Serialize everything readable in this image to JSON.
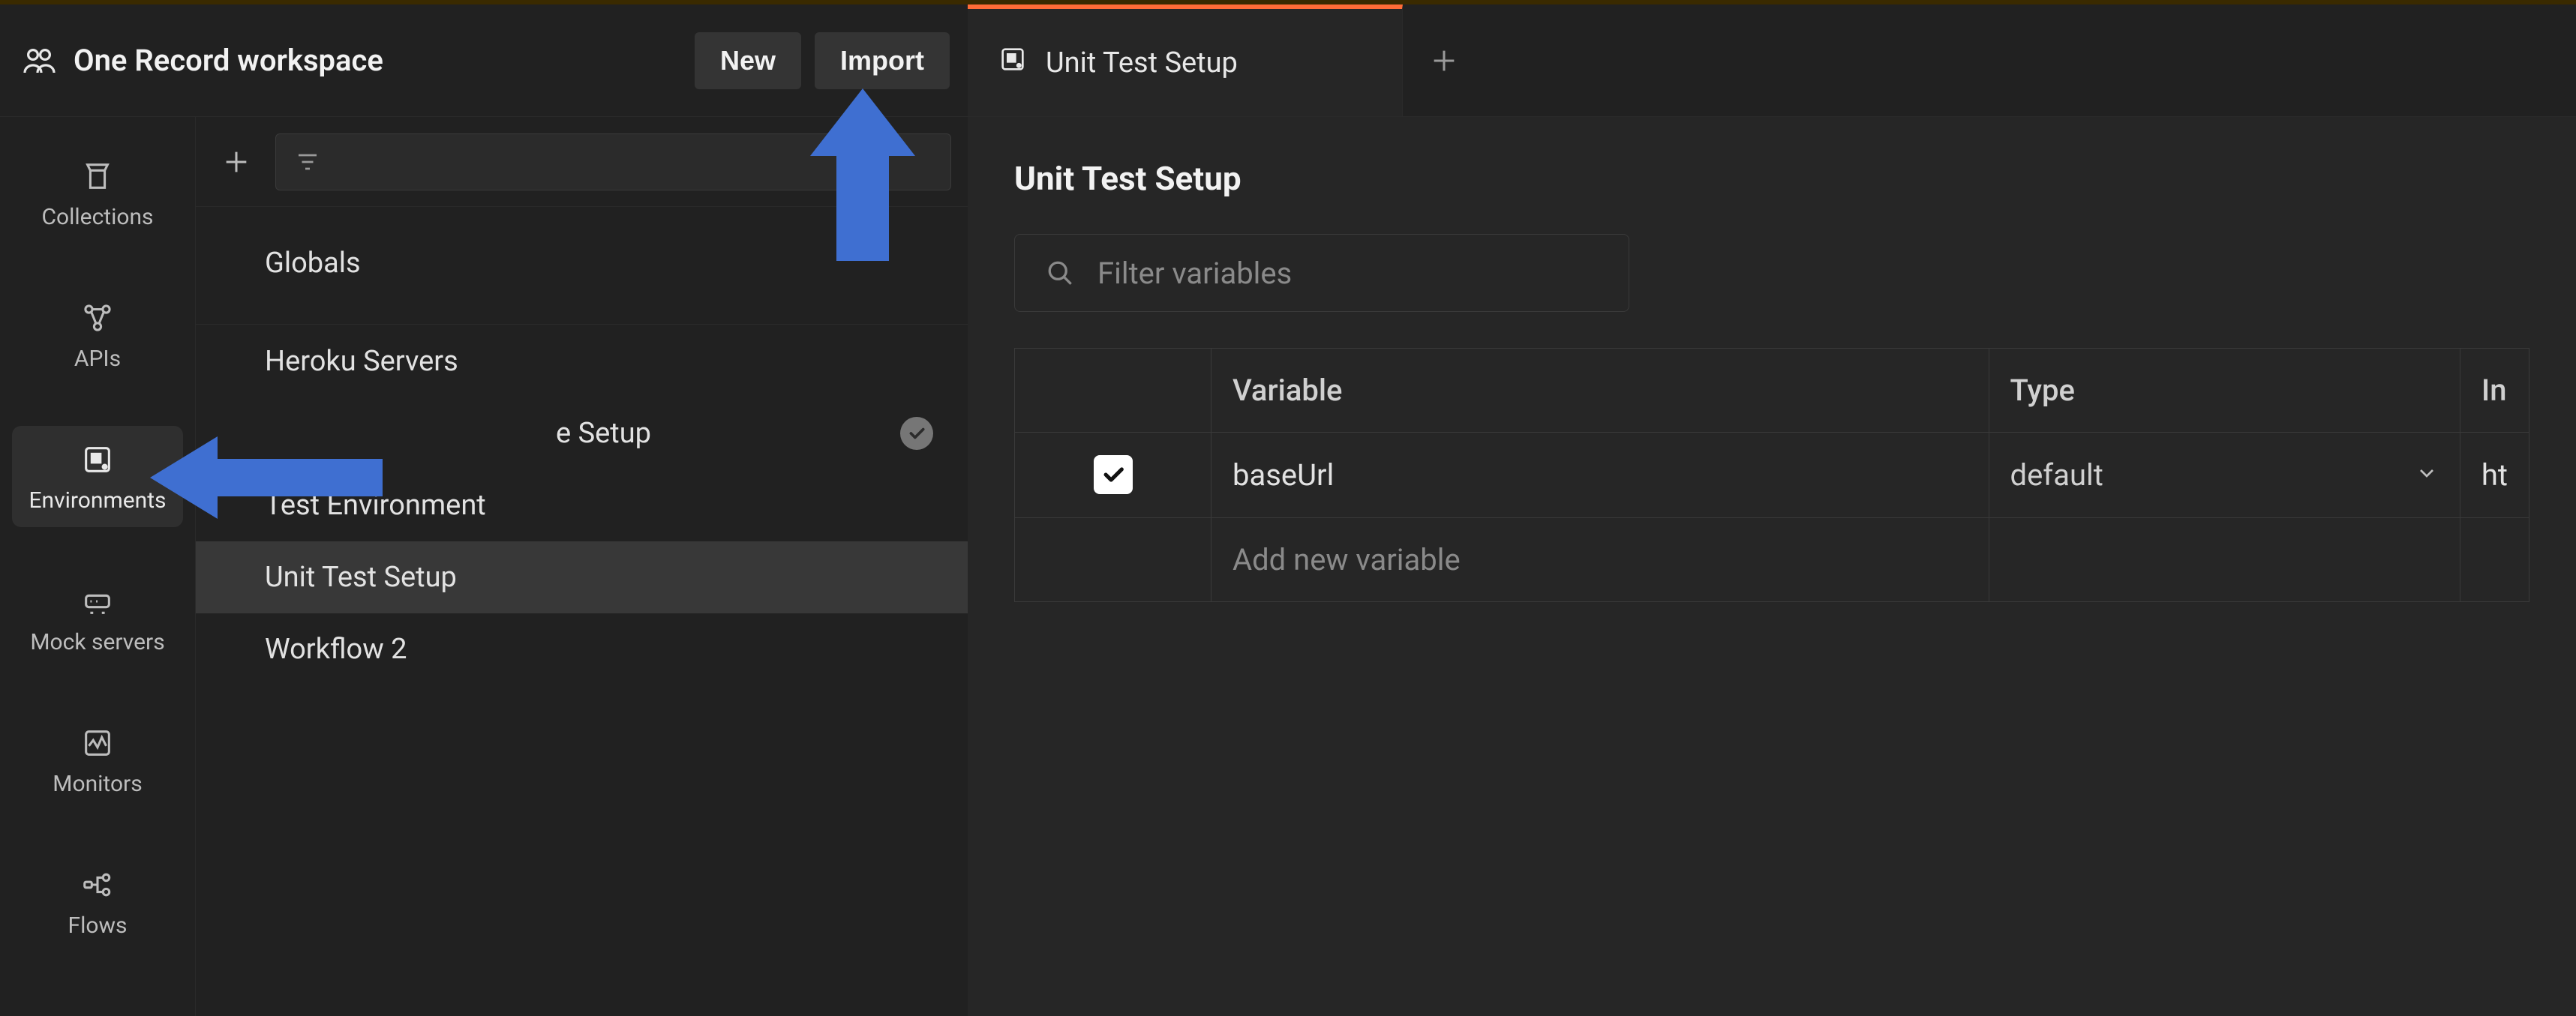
{
  "workspace": {
    "name": "One Record workspace",
    "new_label": "New",
    "import_label": "Import"
  },
  "rail": {
    "items": [
      {
        "id": "collections",
        "label": "Collections"
      },
      {
        "id": "apis",
        "label": "APIs"
      },
      {
        "id": "environments",
        "label": "Environments"
      },
      {
        "id": "mock-servers",
        "label": "Mock servers"
      },
      {
        "id": "monitors",
        "label": "Monitors"
      },
      {
        "id": "flows",
        "label": "Flows"
      }
    ],
    "active": "environments"
  },
  "env_list": {
    "globals_label": "Globals",
    "group_label": "Heroku Servers",
    "items": [
      {
        "label": "e Setup",
        "active_env": true
      },
      {
        "label": "Test Environment",
        "active_env": false
      },
      {
        "label": "Unit Test Setup",
        "active_env": false,
        "selected": true
      },
      {
        "label": "Workflow 2",
        "active_env": false
      }
    ]
  },
  "tabs": {
    "items": [
      {
        "label": "Unit Test Setup",
        "icon": "env"
      }
    ]
  },
  "page": {
    "title": "Unit Test Setup",
    "filter_placeholder": "Filter variables",
    "table": {
      "headers": {
        "variable": "Variable",
        "type": "Type",
        "initial": "In"
      },
      "rows": [
        {
          "checked": true,
          "variable": "baseUrl",
          "type": "default",
          "initial": "ht"
        }
      ],
      "add_placeholder": "Add new variable"
    }
  },
  "colors": {
    "accent": "#ff6c37",
    "arrow": "#3f6fd1"
  }
}
